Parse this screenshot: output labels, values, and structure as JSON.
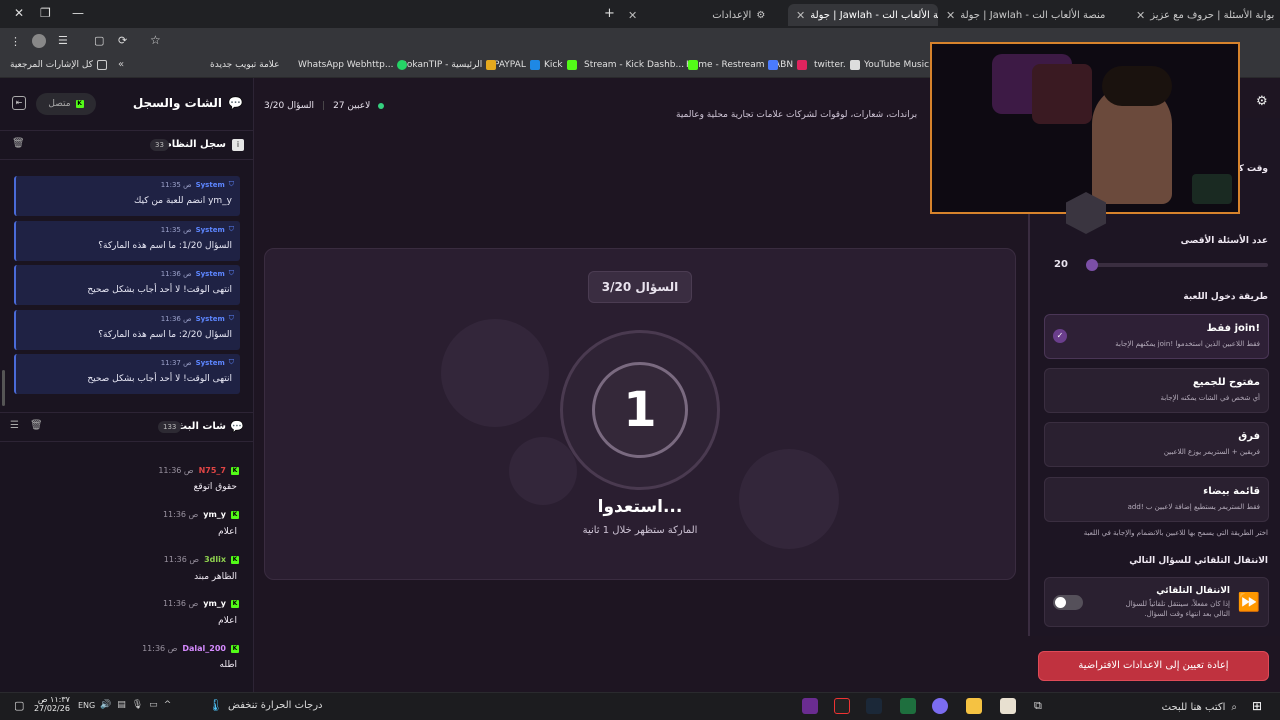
{
  "browser": {
    "tabs": [
      {
        "label": "بوابة الأسئلة | حروف مع عزيز"
      },
      {
        "label": "جولة | Jawlah - منصة الألعاب الت..."
      },
      {
        "label": "جولة | Jawlah - منصة الألعاب الت..."
      },
      {
        "label": "الإعدادات"
      }
    ],
    "bookmarks": [
      {
        "label": "YouTube Music",
        "color": "#ff0000"
      },
      {
        "label": "twitter.",
        "color": "#ffffff"
      },
      {
        "label": "ABN",
        "color": "#e0245e"
      },
      {
        "label": "Home - Restream",
        "color": "#4a7bff"
      },
      {
        "label": "Stream - Kick Dashb...",
        "color": "#53fc18"
      },
      {
        "label": "Kick",
        "color": "#53fc18"
      },
      {
        "label": "PAYPAL",
        "color": "#1e88e5"
      },
      {
        "label": "DokanTIP - الرئيسية",
        "color": "#e5a91e"
      },
      {
        "label": "WhatsApp Webhttp...",
        "color": "#25d366"
      },
      {
        "label": "علامة تبويب جديدة",
        "color": "#888888"
      },
      {
        "label": "كل الإشارات المرجعية",
        "color": "#cccccc"
      }
    ]
  },
  "left": {
    "title": "الشات والسجل",
    "status": "متصل",
    "system_log": {
      "title": "سجل النظام",
      "count": "33",
      "messages": [
        {
          "name": "System",
          "time": "11:35 ص",
          "text": "ym_y انضم للعبة من كيك"
        },
        {
          "name": "System",
          "time": "11:35 ص",
          "text": "السؤال 1/20: ما اسم هذه الماركة؟"
        },
        {
          "name": "System",
          "time": "11:36 ص",
          "text": "انتهى الوقت! لا أحد أجاب بشكل صحيح"
        },
        {
          "name": "System",
          "time": "11:36 ص",
          "text": "السؤال 2/20: ما اسم هذه الماركة؟"
        },
        {
          "name": "System",
          "time": "11:37 ص",
          "text": "انتهى الوقت! لا أحد أجاب بشكل صحيح"
        }
      ]
    },
    "stream_chat": {
      "title": "شات البث",
      "count": "133",
      "messages": [
        {
          "name": "N75_7",
          "name_color": "#e04545",
          "time": "11:36 ص",
          "text": "حقوق اتوقع"
        },
        {
          "name": "ym_y",
          "name_color": "#ffffff",
          "time": "11:36 ص",
          "text": "اعلام"
        },
        {
          "name": "3dlix",
          "name_color": "#8fd14f",
          "time": "11:36 ص",
          "text": "الظاهر مبند"
        },
        {
          "name": "ym_y",
          "name_color": "#ffffff",
          "time": "11:36 ص",
          "text": "اعلام"
        },
        {
          "name": "Dalal_200",
          "name_color": "#d68bff",
          "time": "11:36 ص",
          "text": "اطله"
        }
      ]
    }
  },
  "center": {
    "question_counter": "السؤال 3/20",
    "players": "27 لاعبين",
    "subtitle": "براندات، شعارات، لوقوات لشركات علامات تجارية محلية وعالمية",
    "badge": "السؤال 3/20",
    "countdown": "1",
    "ready": "استعدوا...",
    "hint": "الماركة ستظهر خلال 1 ثانية"
  },
  "right": {
    "time_label": "وقت كل",
    "max_questions_label": "عدد الأسئلة الأقصى",
    "max_questions_value": "20",
    "join_mode_label": "طريقة دخول اللعبة",
    "options": [
      {
        "title": "!join فقط",
        "desc": "فقط اللاعبين الذين استخدموا !join يمكنهم الإجابة",
        "selected": true
      },
      {
        "title": "مفتوح للجميع",
        "desc": "أي شخص في الشات يمكنه الإجابة",
        "selected": false
      },
      {
        "title": "فرق",
        "desc": "فريقين + الستريمر يوزع اللاعبين",
        "selected": false
      },
      {
        "title": "قائمة بيضاء",
        "desc": "فقط الستريمر يستطيع إضافة لاعبين ب !add",
        "selected": false
      }
    ],
    "join_hint": "اختر الطريقة التي يسمح بها للاعبين بالانضمام والإجابة في اللعبة",
    "auto_next_label": "الانتقال التلقائي للسؤال التالي",
    "auto_title": "الانتقال التلقائي",
    "auto_desc1": "إذا كان مفعلاً، سينتقل تلقائياً للسؤال",
    "auto_desc2": "التالي بعد انتهاء وقت السؤال.",
    "reset_button": "إعادة تعيين إلى الاعدادات الافتراضية"
  },
  "taskbar": {
    "search": "اكتب هنا للبحث",
    "weather": "درجات الحرارة تنخفض",
    "lang": "ENG",
    "time": "١١:٣٧ ص",
    "date": "27/02/26"
  }
}
